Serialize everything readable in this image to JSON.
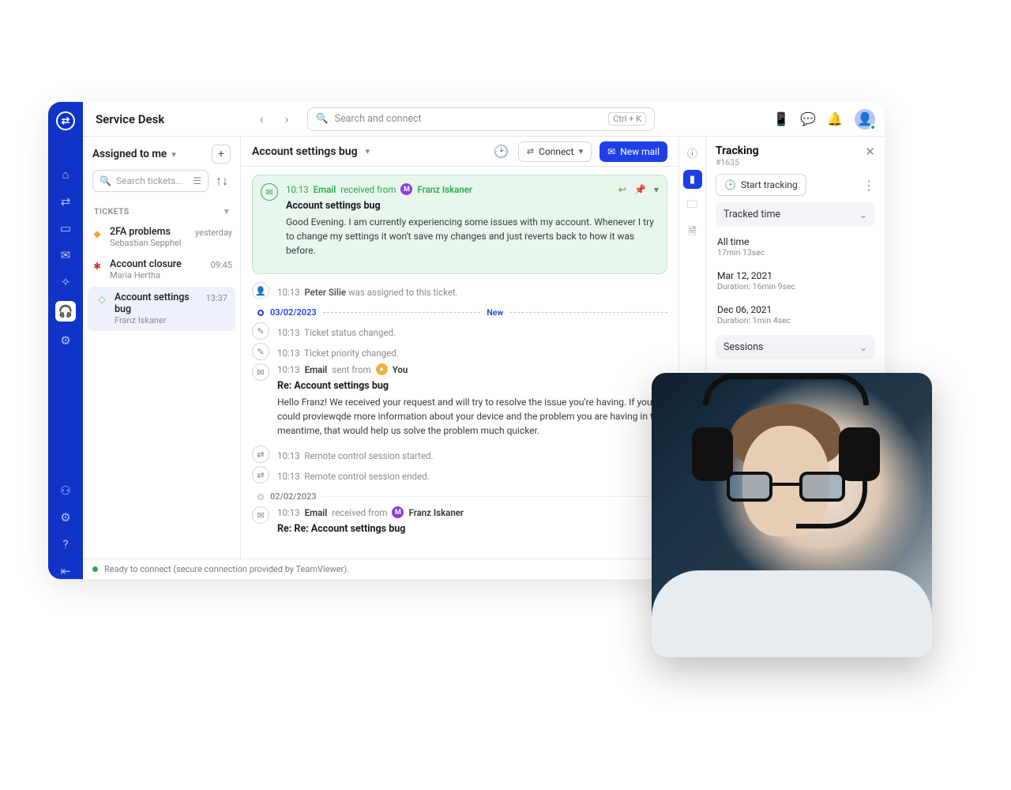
{
  "header": {
    "title": "Service Desk",
    "search_placeholder": "Search and connect",
    "shortcut": "Ctrl + K"
  },
  "list": {
    "filter_label": "Assigned to me",
    "search_placeholder": "Search tickets...",
    "section_label": "TICKETS",
    "items": [
      {
        "title": "2FA problems",
        "sub": "Sebastian Sepphel",
        "meta": "yesterday",
        "color": "#f5a623"
      },
      {
        "title": "Account closure",
        "sub": "Maria Hertha",
        "meta": "09:45",
        "color": "#d0342c"
      },
      {
        "title": "Account settings bug",
        "sub": "Franz Iskaner",
        "meta": "13:37",
        "color": "#8fe074"
      }
    ]
  },
  "thread": {
    "title": "Account settings bug",
    "connect_label": "Connect",
    "newmail_label": "New mail",
    "first": {
      "time": "10:13",
      "kind": "Email",
      "action": "received from",
      "name": "Franz Iskaner",
      "subject": "Account settings bug",
      "body": "Good Evening. I am currently experiencing some issues with my account. Whenever I try to change my settings it won't save my changes and just reverts back to how it was before."
    },
    "assign": {
      "time": "10:13",
      "name": "Peter Silie",
      "suffix": "was assigned to this ticket."
    },
    "date1": "03/02/2023",
    "new_label": "New",
    "status_change": {
      "time": "10:13",
      "text": "Ticket status changed."
    },
    "priority_change": {
      "time": "10:13",
      "text": "Ticket priority changed."
    },
    "reply": {
      "time": "10:13",
      "kind": "Email",
      "action": "sent from",
      "name": "You",
      "subject": "Re: Account settings bug",
      "body": "Hello Franz! We received your request and will try to resolve the issue you're having.  If you could proviewqde more information about your device and the problem you are having in the meantime, that would help us solve the problem much quicker."
    },
    "session_start": {
      "time": "10:13",
      "text": "Remote control session started."
    },
    "session_end": {
      "time": "10:13",
      "text": "Remote control session ended."
    },
    "date2": "02/02/2023",
    "second": {
      "time": "10:13",
      "kind": "Email",
      "action": "received from",
      "name": "Franz Iskaner",
      "subject": "Re: Re: Account settings bug"
    }
  },
  "tracking": {
    "title": "Tracking",
    "id": "#1635",
    "start_label": "Start tracking",
    "section1": "Tracked time",
    "all_time_label": "All time",
    "all_time_value": "17min 13sec",
    "items": [
      {
        "date": "Mar 12, 2021",
        "dur": "Duration: 16min 9sec"
      },
      {
        "date": "Dec 06, 2021",
        "dur": "Duration: 1min 4sec"
      }
    ],
    "section2": "Sessions"
  },
  "status_bar": "Ready to connect (secure connection provided by TeamViewer)."
}
